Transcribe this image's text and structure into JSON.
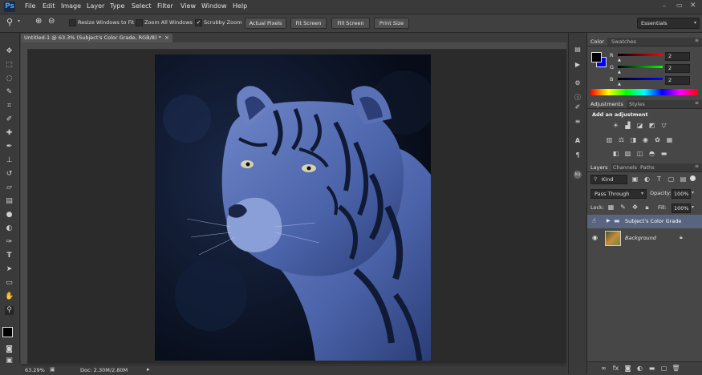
{
  "app": {
    "logo": "Ps"
  },
  "menu": [
    "File",
    "Edit",
    "Image",
    "Layer",
    "Type",
    "Select",
    "Filter",
    "View",
    "Window",
    "Help"
  ],
  "options_bar": {
    "resize_windows": "Resize Windows to Fit",
    "zoom_all_windows": "Zoom All Windows",
    "scrubby_zoom": "Scrubby Zoom",
    "actual_pixels": "Actual Pixels",
    "fit_screen": "Fit Screen",
    "fill_screen": "Fill Screen",
    "print_size": "Print Size",
    "workspace": "Essentials"
  },
  "document": {
    "tab_title": "Untitled-1 @ 63.3% (Subject's Color Grade, RGB/8) *",
    "close": "×"
  },
  "status": {
    "zoom": "63.29%",
    "doc_size": "Doc: 2.30M/2.80M"
  },
  "color_panel": {
    "tabs": [
      "Color",
      "Swatches"
    ],
    "r_label": "R",
    "g_label": "G",
    "b_label": "B",
    "r": "2",
    "g": "2",
    "b": "2"
  },
  "adjustments_panel": {
    "tabs": [
      "Adjustments",
      "Styles"
    ],
    "heading": "Add an adjustment"
  },
  "layers_panel": {
    "tabs": [
      "Layers",
      "Channels",
      "Paths"
    ],
    "filter_kind": "Kind",
    "blend_mode": "Pass Through",
    "opacity_label": "Opacity:",
    "opacity": "100%",
    "lock_label": "Lock:",
    "fill_label": "Fill:",
    "fill": "100%",
    "layers": [
      {
        "name": "Subject's Color Grade",
        "type": "group",
        "selected": true
      },
      {
        "name": "Background",
        "type": "image",
        "locked": true
      }
    ]
  },
  "colors": {
    "accent_foreground": "#000000",
    "accent_background": "#0000ff",
    "selected_layer": "#596580"
  }
}
